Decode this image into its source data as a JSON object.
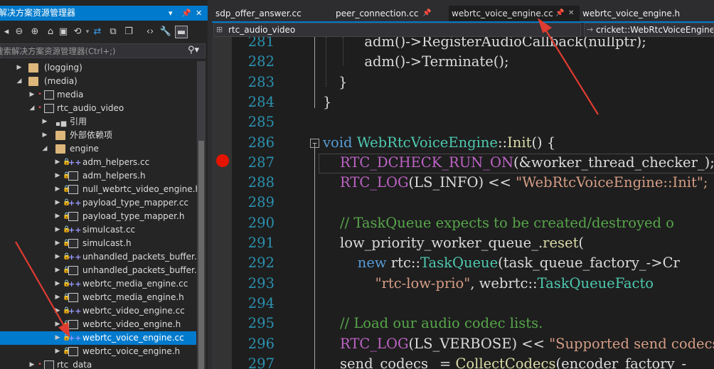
{
  "solution_explorer": {
    "title": "解决方案资源管理器",
    "search_placeholder": "搜索解决方案资源管理器(Ctrl+;)",
    "tree": [
      {
        "label": "(logging)",
        "kind": "folder"
      },
      {
        "label": "(media)",
        "kind": "folder-open"
      },
      {
        "label": "media",
        "kind": "project"
      },
      {
        "label": "rtc_audio_video",
        "kind": "project"
      },
      {
        "label": "引用",
        "kind": "refs"
      },
      {
        "label": "外部依赖项",
        "kind": "deps"
      },
      {
        "label": "engine",
        "kind": "folder-open"
      },
      {
        "label": "adm_helpers.cc",
        "kind": "cc"
      },
      {
        "label": "adm_helpers.h",
        "kind": "h"
      },
      {
        "label": "null_webrtc_video_engine.h",
        "kind": "h"
      },
      {
        "label": "payload_type_mapper.cc",
        "kind": "cc"
      },
      {
        "label": "payload_type_mapper.h",
        "kind": "h"
      },
      {
        "label": "simulcast.cc",
        "kind": "cc"
      },
      {
        "label": "simulcast.h",
        "kind": "h"
      },
      {
        "label": "unhandled_packets_buffer.cc",
        "kind": "cc"
      },
      {
        "label": "unhandled_packets_buffer.h",
        "kind": "h"
      },
      {
        "label": "webrtc_media_engine.cc",
        "kind": "cc"
      },
      {
        "label": "webrtc_media_engine.h",
        "kind": "h"
      },
      {
        "label": "webrtc_video_engine.cc",
        "kind": "cc"
      },
      {
        "label": "webrtc_video_engine.h",
        "kind": "h"
      },
      {
        "label": "webrtc_voice_engine.cc",
        "kind": "cc",
        "selected": true
      },
      {
        "label": "webrtc_voice_engine.h",
        "kind": "h"
      },
      {
        "label": "rtc_data",
        "kind": "project"
      }
    ]
  },
  "tabs": [
    {
      "label": "sdp_offer_answer.cc"
    },
    {
      "label": "peer_connection.cc"
    },
    {
      "label": "webrtc_voice_engine.cc",
      "active": true
    },
    {
      "label": "webrtc_voice_engine.h"
    }
  ],
  "nav": {
    "project": "rtc_audio_video",
    "scope": "cricket::WebRtcVoiceEngine"
  },
  "code": {
    "breakpoint_line": 287,
    "lines": [
      {
        "n": "281",
        "tokens": [
          {
            "t": "  adm()->RegisterAudioCallback(nullptr);",
            "c": ""
          }
        ]
      },
      {
        "n": "282",
        "tokens": [
          {
            "t": "  adm()->Terminate();",
            "c": ""
          }
        ]
      },
      {
        "n": "283",
        "tokens": [
          {
            "t": "}",
            "c": ""
          }
        ]
      },
      {
        "n": "284",
        "tokens": [
          {
            "t": "}",
            "c": ""
          }
        ]
      },
      {
        "n": "285",
        "tokens": []
      },
      {
        "n": "286",
        "tokens": [
          {
            "t": "void ",
            "c": "kw"
          },
          {
            "t": "WebRtcVoiceEngine",
            "c": "ty"
          },
          {
            "t": "::",
            "c": ""
          },
          {
            "t": "Init",
            "c": "fn"
          },
          {
            "t": "() {",
            "c": ""
          }
        ]
      },
      {
        "n": "287",
        "tokens": [
          {
            "t": "RTC_DCHECK_RUN_ON",
            "c": "mac"
          },
          {
            "t": "(&worker_thread_checker_);",
            "c": ""
          }
        ]
      },
      {
        "n": "288",
        "tokens": [
          {
            "t": "RTC_LOG",
            "c": "mac"
          },
          {
            "t": "(LS_INFO) << ",
            "c": ""
          },
          {
            "t": "\"WebRtcVoiceEngine::Init\";",
            "c": "str"
          }
        ]
      },
      {
        "n": "289",
        "tokens": []
      },
      {
        "n": "290",
        "tokens": [
          {
            "t": "// TaskQueue expects to be created/destroyed o",
            "c": "cm"
          }
        ]
      },
      {
        "n": "291",
        "tokens": [
          {
            "t": "low_priority_worker_queue_.",
            "c": ""
          },
          {
            "t": "reset",
            "c": "fn"
          },
          {
            "t": "(",
            "c": ""
          }
        ]
      },
      {
        "n": "292",
        "tokens": [
          {
            "t": "    ",
            "c": ""
          },
          {
            "t": "new ",
            "c": "kw"
          },
          {
            "t": "rtc::",
            "c": ""
          },
          {
            "t": "TaskQueue",
            "c": "ty"
          },
          {
            "t": "(task_queue_factory_->Cr",
            "c": ""
          }
        ]
      },
      {
        "n": "293",
        "tokens": [
          {
            "t": "        ",
            "c": ""
          },
          {
            "t": "\"rtc-low-prio\"",
            "c": "str"
          },
          {
            "t": ", webrtc::",
            "c": ""
          },
          {
            "t": "TaskQueueFacto",
            "c": "ty"
          }
        ]
      },
      {
        "n": "294",
        "tokens": []
      },
      {
        "n": "295",
        "tokens": [
          {
            "t": "// Load our audio codec lists.",
            "c": "cm"
          }
        ]
      },
      {
        "n": "296",
        "tokens": [
          {
            "t": "RTC_LOG",
            "c": "mac"
          },
          {
            "t": "(LS_VERBOSE) << ",
            "c": ""
          },
          {
            "t": "\"Supported send codecs",
            "c": "str"
          }
        ]
      },
      {
        "n": "297",
        "tokens": [
          {
            "t": "send_codecs_ = ",
            "c": ""
          },
          {
            "t": "CollectCodecs",
            "c": "fn"
          },
          {
            "t": "(encoder_factory_-",
            "c": ""
          }
        ]
      }
    ]
  },
  "colors": {
    "accent": "#007acc",
    "breakpoint": "#e51400",
    "annotation_arrow": "#e03c31"
  }
}
